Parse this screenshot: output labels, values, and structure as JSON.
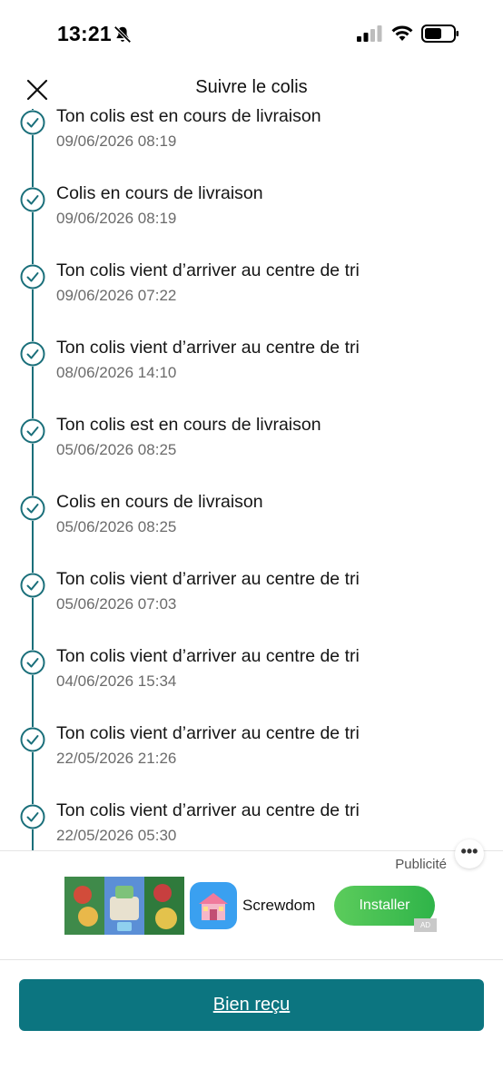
{
  "status_bar": {
    "time": "13:21",
    "icons": [
      "bell-slash-icon",
      "cellular-signal-icon",
      "wifi-icon",
      "battery-icon"
    ]
  },
  "header": {
    "title": "Suivre le colis",
    "close_icon": "close-icon"
  },
  "colors": {
    "accent": "#0c7580",
    "timeline": "#1a6f7a",
    "install_button": "#3dbb50"
  },
  "timeline": {
    "events": [
      {
        "title": "Ton colis est en cours de livraison",
        "date": "09/06/2026 08:19"
      },
      {
        "title": "Colis en cours de livraison",
        "date": "09/06/2026 08:19"
      },
      {
        "title": "Ton colis vient d’arriver au centre de tri",
        "date": "09/06/2026 07:22"
      },
      {
        "title": "Ton colis vient d’arriver au centre de tri",
        "date": "08/06/2026 14:10"
      },
      {
        "title": "Ton colis est en cours de livraison",
        "date": "05/06/2026 08:25"
      },
      {
        "title": "Colis en cours de livraison",
        "date": "05/06/2026 08:25"
      },
      {
        "title": "Ton colis vient d’arriver au centre de tri",
        "date": "05/06/2026 07:03"
      },
      {
        "title": "Ton colis vient d’arriver au centre de tri",
        "date": "04/06/2026 15:34"
      },
      {
        "title": "Ton colis vient d’arriver au centre de tri",
        "date": "22/05/2026 21:26"
      },
      {
        "title": "Ton colis vient d’arriver au centre de tri",
        "date": "22/05/2026 05:30"
      }
    ]
  },
  "ad": {
    "label": "Publicité",
    "app_name": "Screwdom",
    "install_label": "Installer",
    "badge": "AD"
  },
  "footer": {
    "confirm_label": "Bien reçu"
  }
}
